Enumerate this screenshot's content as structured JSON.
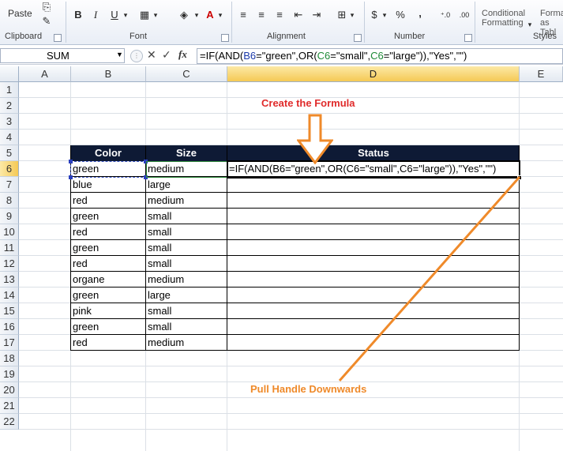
{
  "ribbon": {
    "clipboard": {
      "paste_label": "Paste",
      "group_label": "Clipboard"
    },
    "font": {
      "group_label": "Font",
      "bold": "B",
      "italic": "I",
      "underline": "U"
    },
    "alignment": {
      "group_label": "Alignment"
    },
    "number": {
      "group_label": "Number",
      "currency": "$",
      "percent": "%",
      "comma": ","
    },
    "styles": {
      "conditional_line1": "Conditional",
      "conditional_line2": "Formatting",
      "format_table_line1": "Forma",
      "format_table_line2": "as Tabl",
      "group_label": "Styles"
    }
  },
  "formula_bar": {
    "name_box": "SUM",
    "fx_label": "fx",
    "formula": "=IF(AND(B6=\"green\",OR(C6=\"small\",C6=\"large\")),\"Yes\",\"\")"
  },
  "columns": [
    "A",
    "B",
    "C",
    "D",
    "E"
  ],
  "rows": [
    "1",
    "2",
    "3",
    "4",
    "5",
    "6",
    "7",
    "8",
    "9",
    "10",
    "11",
    "12",
    "13",
    "14",
    "15",
    "16",
    "17",
    "18",
    "19",
    "20",
    "21",
    "22"
  ],
  "table": {
    "headers": [
      "Color",
      "Size",
      "Status"
    ],
    "rows": [
      {
        "color": "green",
        "size": "medium",
        "status": "=IF(AND(B6=\"green\",OR(C6=\"small\",C6=\"large\")),\"Yes\",\"\")"
      },
      {
        "color": "blue",
        "size": "large",
        "status": ""
      },
      {
        "color": "red",
        "size": "medium",
        "status": ""
      },
      {
        "color": "green",
        "size": "small",
        "status": ""
      },
      {
        "color": "red",
        "size": "small",
        "status": ""
      },
      {
        "color": "green",
        "size": "small",
        "status": ""
      },
      {
        "color": "red",
        "size": "small",
        "status": ""
      },
      {
        "color": "organe",
        "size": "medium",
        "status": ""
      },
      {
        "color": "green",
        "size": "large",
        "status": ""
      },
      {
        "color": "pink",
        "size": "small",
        "status": ""
      },
      {
        "color": "green",
        "size": "small",
        "status": ""
      },
      {
        "color": "red",
        "size": "medium",
        "status": ""
      }
    ]
  },
  "annotations": {
    "create_formula": "Create the Formula",
    "pull_handle": "Pull Handle Downwards",
    "red_color": "#e02b2b",
    "orange_color": "#ef8a2a"
  }
}
